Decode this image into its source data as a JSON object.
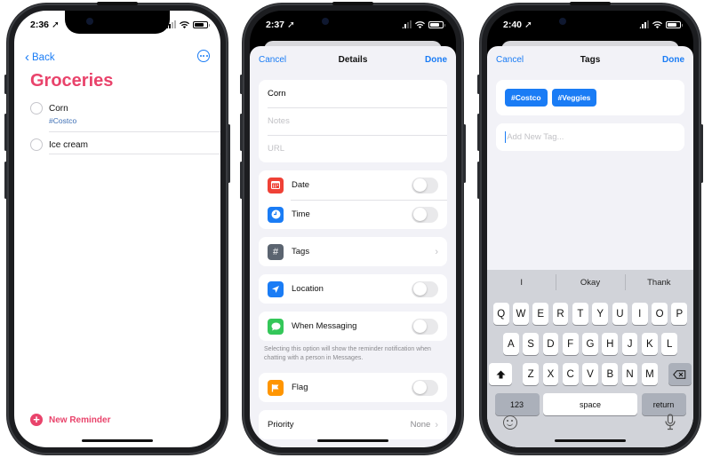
{
  "phones": [
    {
      "status": {
        "time": "2:36"
      },
      "nav": {
        "back_label": "Back",
        "more_icon": "ellipsis-circle-icon"
      },
      "list_title": "Groceries",
      "items": [
        {
          "name": "Corn",
          "tag": "#Costco"
        },
        {
          "name": "Ice cream",
          "tag": ""
        }
      ],
      "new_reminder_label": "New Reminder"
    },
    {
      "status": {
        "time": "2:37"
      },
      "sheet": {
        "cancel": "Cancel",
        "title": "Details",
        "done": "Done"
      },
      "fields": {
        "title_value": "Corn",
        "notes_placeholder": "Notes",
        "url_placeholder": "URL"
      },
      "rows": {
        "date": {
          "label": "Date",
          "on": false,
          "color": "#ef4136"
        },
        "time": {
          "label": "Time",
          "on": false,
          "color": "#1a7cf5"
        },
        "tags": {
          "label": "Tags",
          "color": "#5b6470"
        },
        "location": {
          "label": "Location",
          "on": false,
          "color": "#1a7cf5"
        },
        "messaging": {
          "label": "When Messaging",
          "on": false,
          "color": "#34c759"
        },
        "flag": {
          "label": "Flag",
          "on": false,
          "color": "#ff9500"
        },
        "priority": {
          "label": "Priority",
          "value": "None"
        }
      },
      "messaging_footnote": "Selecting this option will show the reminder notification when chatting with a person in Messages."
    },
    {
      "status": {
        "time": "2:40"
      },
      "sheet": {
        "cancel": "Cancel",
        "title": "Tags",
        "done": "Done"
      },
      "tags": [
        "#Costco",
        "#Veggies"
      ],
      "new_tag_placeholder": "Add New Tag...",
      "keyboard": {
        "suggestions": [
          "I",
          "Okay",
          "Thank"
        ],
        "row1": [
          "Q",
          "W",
          "E",
          "R",
          "T",
          "Y",
          "U",
          "I",
          "O",
          "P"
        ],
        "row2": [
          "A",
          "S",
          "D",
          "F",
          "G",
          "H",
          "J",
          "K",
          "L"
        ],
        "row3": [
          "Z",
          "X",
          "C",
          "V",
          "B",
          "N",
          "M"
        ],
        "numbers_label": "123",
        "space_label": "space",
        "return_label": "return"
      }
    }
  ],
  "colors": {
    "accent_blue": "#1a7cf5",
    "reminders_red": "#e9436b"
  }
}
